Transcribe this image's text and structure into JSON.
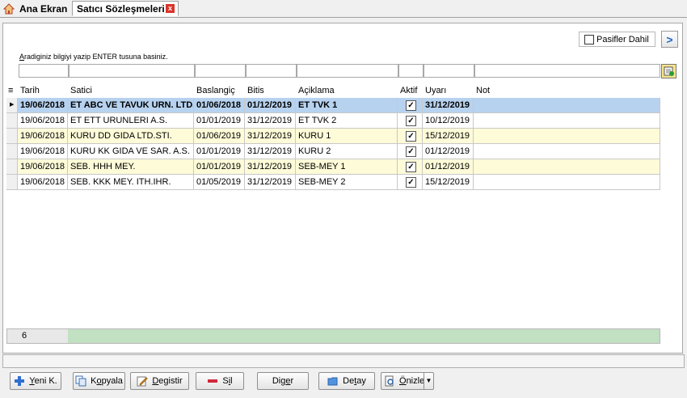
{
  "tabs": {
    "home_label": "Ana Ekran",
    "active_label": "Satıcı Sözleşmeleri",
    "close_glyph": "x"
  },
  "toolbar": {
    "pasif_label": "Pasifler Dahil",
    "nav_glyph": ">"
  },
  "search": {
    "hint_underline": "A",
    "hint_rest": "radiginiz bilgiyi yazip ENTER tusuna basiniz."
  },
  "columns": [
    "Tarih",
    "Satici",
    "Baslangiç",
    "Bitis",
    "Açiklama",
    "Aktif",
    "Uyarı",
    "Not"
  ],
  "rows": [
    {
      "tarih": "19/06/2018",
      "satici": "ET ABC VE TAVUK URN. LTD.ŞTİ",
      "baslangic": "01/06/2018",
      "bitis": "01/12/2019",
      "aciklama": "ET TVK 1",
      "aktif": true,
      "uyari": "31/12/2019",
      "not": ""
    },
    {
      "tarih": "19/06/2018",
      "satici": "ET ETT URUNLERI A.S.",
      "baslangic": "01/01/2019",
      "bitis": "31/12/2019",
      "aciklama": "ET TVK 2",
      "aktif": true,
      "uyari": "10/12/2019",
      "not": ""
    },
    {
      "tarih": "19/06/2018",
      "satici": "KURU DD GIDA LTD.STI.",
      "baslangic": "01/06/2019",
      "bitis": "31/12/2019",
      "aciklama": "KURU 1",
      "aktif": true,
      "uyari": "15/12/2019",
      "not": ""
    },
    {
      "tarih": "19/06/2018",
      "satici": "KURU KK GIDA VE SAR. A.S.",
      "baslangic": "01/01/2019",
      "bitis": "31/12/2019",
      "aciklama": "KURU 2",
      "aktif": true,
      "uyari": "01/12/2019",
      "not": ""
    },
    {
      "tarih": "19/06/2018",
      "satici": "SEB. HHH  MEY.",
      "baslangic": "01/01/2019",
      "bitis": "31/12/2019",
      "aciklama": "SEB-MEY 1",
      "aktif": true,
      "uyari": "01/12/2019",
      "not": ""
    },
    {
      "tarih": "19/06/2018",
      "satici": "SEB. KKK MEY. ITH.IHR.",
      "baslangic": "01/05/2019",
      "bitis": "31/12/2019",
      "aciklama": "SEB-MEY 2",
      "aktif": true,
      "uyari": "15/12/2019",
      "not": ""
    }
  ],
  "footer": {
    "count": "6"
  },
  "buttons": [
    {
      "name": "yeni-button",
      "u": "Y",
      "rest": "eni K.",
      "icon": "plus-icon"
    },
    {
      "name": "kopyala-button",
      "pre": "K",
      "u": "o",
      "rest": "pyala",
      "icon": "copy-icon"
    },
    {
      "name": "degistir-button",
      "u": "D",
      "rest": "egistir",
      "icon": "edit-icon"
    },
    {
      "name": "sil-button",
      "pre": "S",
      "u": "i",
      "rest": "l",
      "icon": "delete-icon"
    },
    {
      "name": "diger-button",
      "pre": "Dig",
      "u": "e",
      "rest": "r",
      "icon": ""
    },
    {
      "name": "detay-button",
      "pre": "De",
      "u": "t",
      "rest": "ay",
      "icon": "folder-icon"
    },
    {
      "name": "onizle-button",
      "u": "Ö",
      "rest": "nizle",
      "icon": "preview-icon"
    }
  ],
  "colors": {
    "selected_row": "#b7d2ef",
    "alt_row": "#fdfbd8",
    "footer_green": "#c2e0c2"
  }
}
